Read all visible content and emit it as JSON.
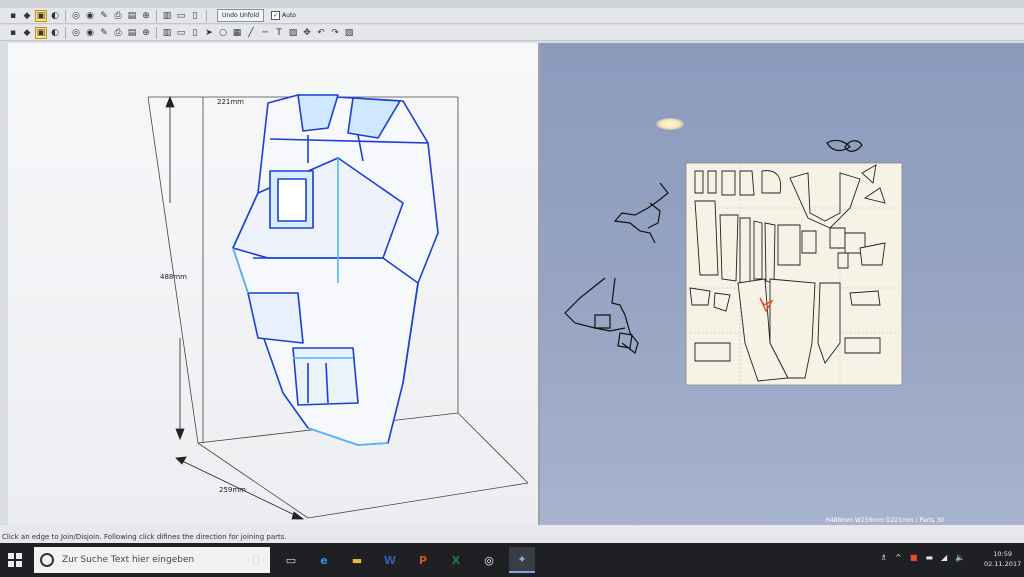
{
  "toolbar": {
    "undo_unfold_label": "Undo Unfold",
    "auto_label": "Auto",
    "auto_checked": true,
    "row1_icons": [
      "open-icon",
      "save-icon",
      "select-icon",
      "rotate-icon",
      "zoom-icon",
      "zoom-out-icon",
      "paint-icon",
      "print-icon",
      "fold-icon",
      "join-icon",
      "view-icon",
      "window-icon",
      "window2-icon"
    ],
    "row2_icons": [
      "pointer-icon",
      "lasso-icon",
      "select-faces-icon",
      "edge-icon",
      "line-icon",
      "text-icon",
      "image-icon",
      "move-icon",
      "undo-icon",
      "redo-icon",
      "split-icon",
      "texture-icon",
      "grid-icon",
      "page-icon",
      "layout-icon",
      "print2-icon",
      "export-icon",
      "align-left-icon",
      "align-center-icon",
      "align-right-icon",
      "flap-icon",
      "number-icon",
      "layer-icon",
      "zoom-fit-icon"
    ]
  },
  "model_view": {
    "width_label": "221mm",
    "height_label": "488mm",
    "depth_label": "259mm"
  },
  "status": {
    "hint": "Click an edge to Join/Disjoin. Following click difines the direction for joining parts.",
    "dimensions": "H488mm W259mm D221mm / Parts 30"
  },
  "taskbar": {
    "search_placeholder": "Zur Suche Text hier eingeben",
    "apps": [
      {
        "name": "task-view-icon",
        "glyph": "▭"
      },
      {
        "name": "edge-browser-icon",
        "glyph": "e"
      },
      {
        "name": "file-explorer-icon",
        "glyph": "▬"
      },
      {
        "name": "word-icon",
        "glyph": "W"
      },
      {
        "name": "powerpoint-icon",
        "glyph": "P"
      },
      {
        "name": "excel-icon",
        "glyph": "X"
      },
      {
        "name": "media-player-icon",
        "glyph": "◎"
      },
      {
        "name": "pepakura-icon",
        "glyph": "✦"
      }
    ],
    "time": "10:59",
    "date": "02.11.2017"
  },
  "colors": {
    "model_edge": "#1a3fd6",
    "model_edge_light": "#4fb6ff",
    "viewport_blue": "#8c9bbd",
    "paper": "#f6f2e6",
    "cut_line": "#111111",
    "marker": "#e04a1a"
  }
}
